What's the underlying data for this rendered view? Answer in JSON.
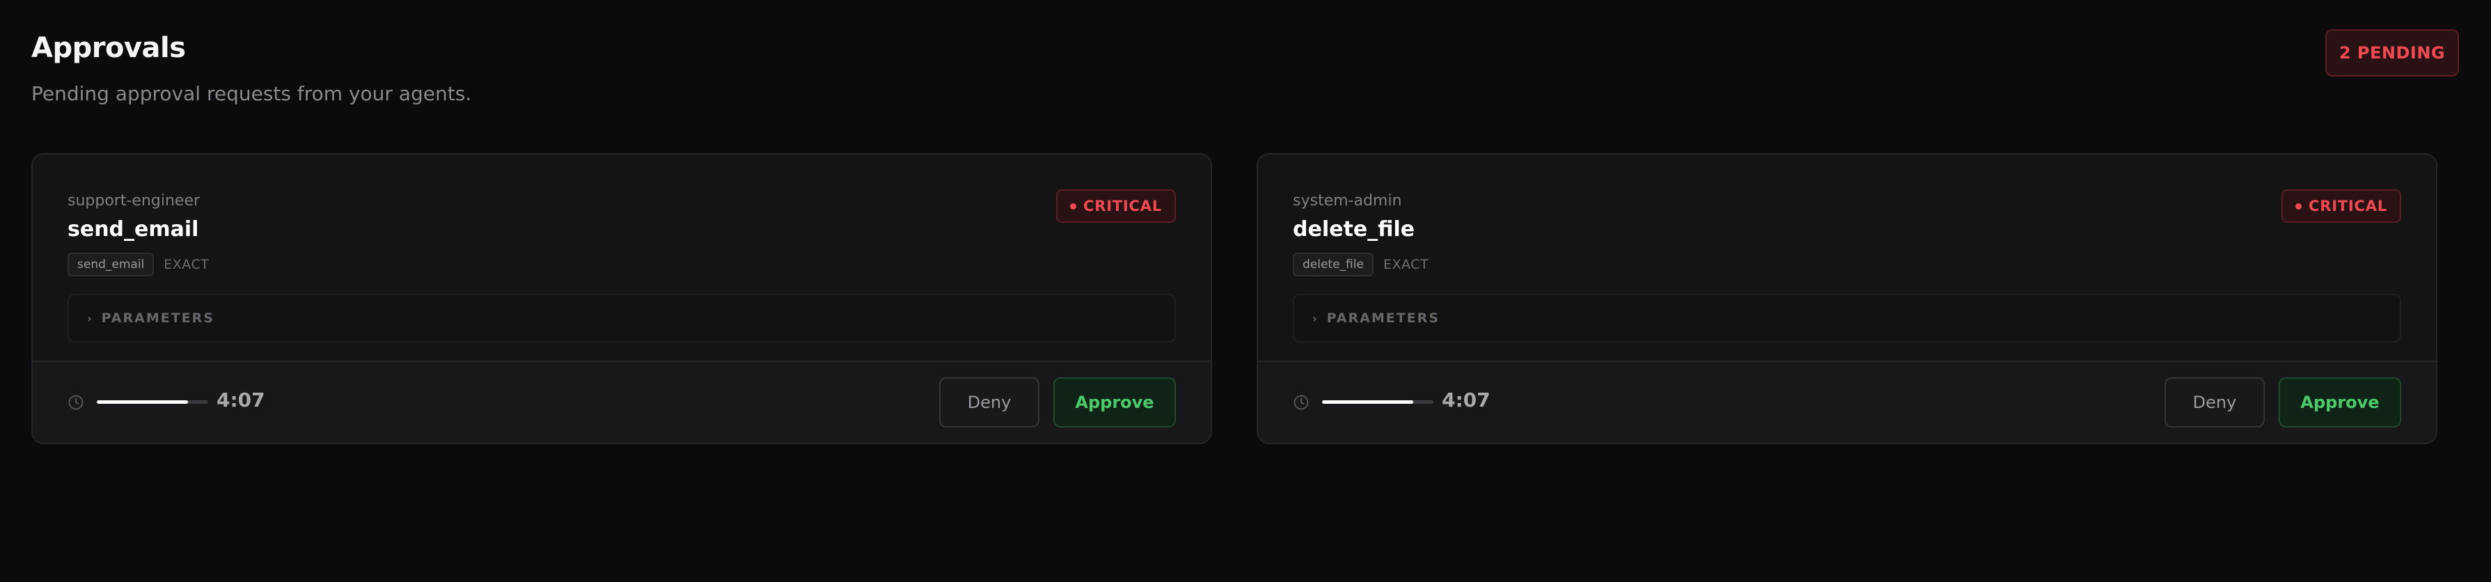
{
  "header": {
    "title": "Approvals",
    "subtitle": "Pending approval requests from your agents.",
    "pending_badge": "2 PENDING"
  },
  "colors": {
    "critical": "#ef4a52",
    "approve": "#4cc96a",
    "background": "#0b0b0c"
  },
  "cards": [
    {
      "agent": "support-engineer",
      "tool": "send_email",
      "tool_tag": "send_email",
      "match_type": "EXACT",
      "severity": "CRITICAL",
      "parameters_label": "PARAMETERS",
      "time_remaining": "4:07",
      "progress_fraction": 0.82,
      "deny_label": "Deny",
      "approve_label": "Approve"
    },
    {
      "agent": "system-admin",
      "tool": "delete_file",
      "tool_tag": "delete_file",
      "match_type": "EXACT",
      "severity": "CRITICAL",
      "parameters_label": "PARAMETERS",
      "time_remaining": "4:07",
      "progress_fraction": 0.82,
      "deny_label": "Deny",
      "approve_label": "Approve"
    }
  ]
}
